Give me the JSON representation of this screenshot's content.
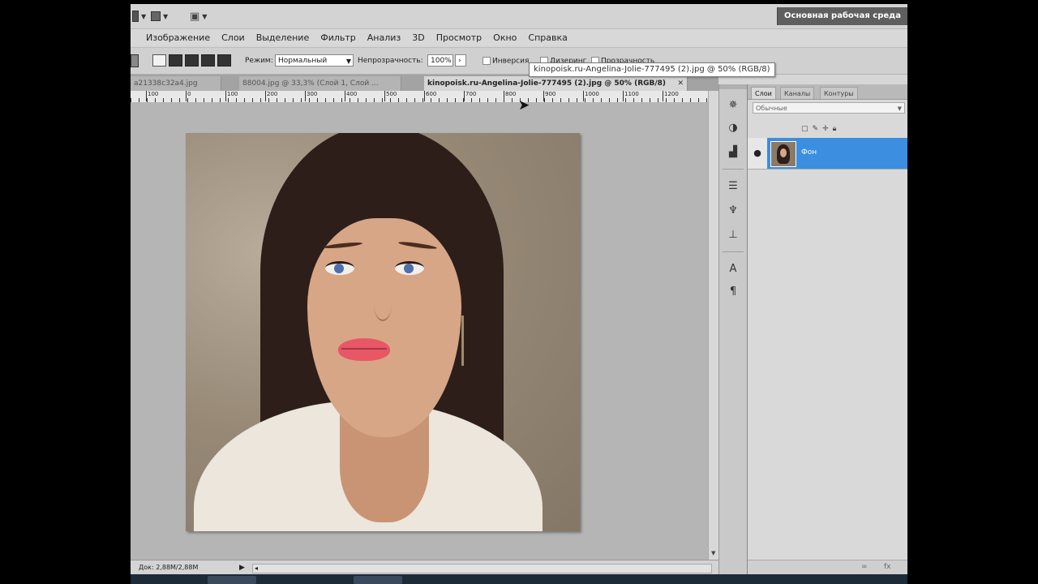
{
  "appbar": {
    "workspace": "Основная рабочая среда"
  },
  "menu": [
    "Изображение",
    "Слои",
    "Выделение",
    "Фильтр",
    "Анализ",
    "3D",
    "Просмотр",
    "Окно",
    "Справка"
  ],
  "options": {
    "mode_label": "Режим:",
    "mode_value": "Нормальный",
    "opacity_label": "Непрозрачность:",
    "opacity_value": "100%",
    "inverse_label": "Инверсия",
    "dither_label": "Дизеринг",
    "transparency_label": "Прозрачность"
  },
  "tooltip": "kinopoisk.ru-Angelina-Jolie-777495 (2).jpg @ 50% (RGB/8)",
  "doc_tabs": [
    {
      "label": "a21338c32a4.jpg",
      "active": false
    },
    {
      "label": "88004.jpg @ 33,3% (Слой 1, Слой ...",
      "active": false
    },
    {
      "label": "kinopoisk.ru-Angelina-Jolie-777495 (2).jpg @ 50% (RGB/8)",
      "active": true
    }
  ],
  "ruler_ticks": [
    "100",
    "0",
    "100",
    "200",
    "300",
    "400",
    "500",
    "600",
    "700",
    "800",
    "900",
    "1000",
    "1100",
    "1200"
  ],
  "status": {
    "doc": "Док: 2,88М/2,88М"
  },
  "layers_panel": {
    "tabs": [
      "Слои",
      "Каналы",
      "Контуры"
    ],
    "blend_mode": "Обычные",
    "layer_name": "Фон",
    "footer": [
      "∞",
      "fx"
    ]
  },
  "dock_icons": [
    "navigator-icon",
    "adjustments-icon",
    "histogram-icon",
    "tool-presets-icon",
    "brushes-icon",
    "clone-source-icon",
    "character-icon",
    "paragraph-icon"
  ]
}
